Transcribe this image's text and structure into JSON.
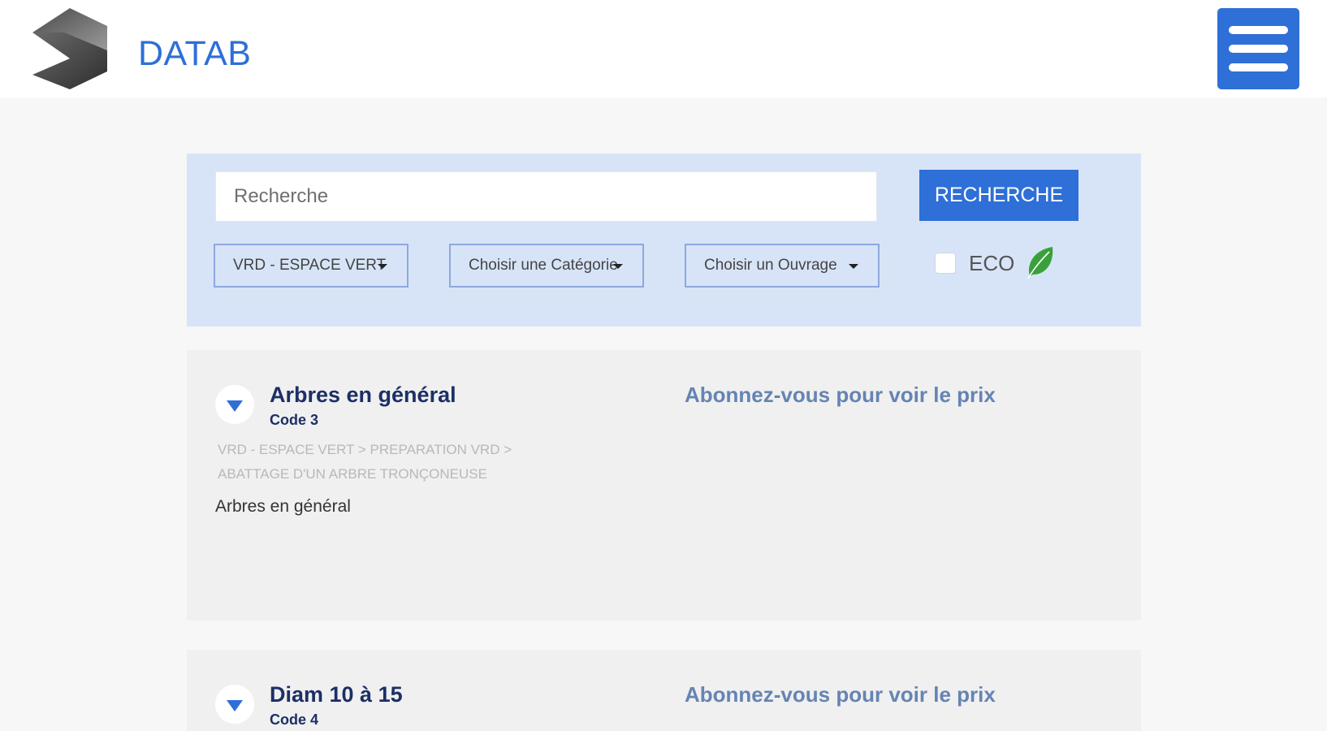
{
  "header": {
    "brand": "DATAB",
    "logo_icon": "cube-logo-icon",
    "menu_icon": "hamburger-menu-icon"
  },
  "search": {
    "placeholder": "Recherche",
    "value": "",
    "button_label": "RECHERCHE",
    "filters": [
      {
        "label": "VRD - ESPACE VERT"
      },
      {
        "label": "Choisir une Catégorie"
      },
      {
        "label": "Choisir un Ouvrage"
      }
    ],
    "eco_label": "ECO",
    "eco_checked": false,
    "eco_icon": "leaf-icon"
  },
  "results": [
    {
      "title": "Arbres en général",
      "code": "Code 3",
      "breadcrumb": "VRD - ESPACE VERT  >  PREPARATION VRD  >  ABATTAGE D'UN ARBRE TRONÇONEUSE",
      "description": "Arbres en général",
      "price_text": "Abonnez-vous pour voir le prix"
    },
    {
      "title": "Diam 10 à  15",
      "code": "Code 4",
      "price_text": "Abonnez-vous pour voir le prix"
    }
  ],
  "colors": {
    "primary": "#2e6fd8",
    "panel": "#d7e4f7",
    "title": "#1c2f66",
    "price_link": "#6584b3",
    "eco_leaf": "#3aa13a"
  }
}
